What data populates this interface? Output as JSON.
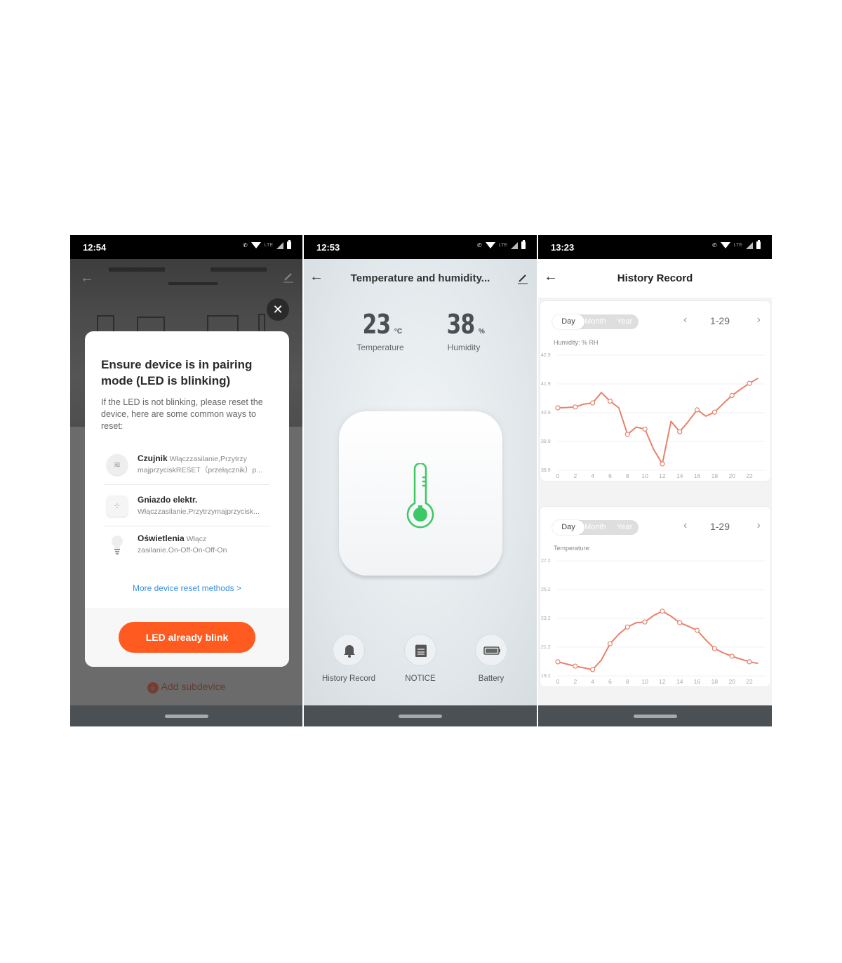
{
  "screens": [
    {
      "status": {
        "time": "12:54",
        "lte": "LTE"
      },
      "modal": {
        "title": "Ensure device is in pairing mode (LED is blinking)",
        "description": "If the LED is not blinking, please reset the device, here are some common ways to reset:",
        "methods": [
          {
            "icon": "sensor-icon",
            "name": "Czujnik",
            "text1": "Włączzasilanie,Przytrzy",
            "text2": "majprzyciskRESET（przełącznik）p..."
          },
          {
            "icon": "socket-icon",
            "name": "Gniazdo elektr.",
            "text1": "",
            "text2": "Włączzasilanie,Przytrzymajprzycisk..."
          },
          {
            "icon": "bulb-icon",
            "name": "Oświetlenia",
            "text1": "Włącz",
            "text2": "zasilanie.On-Off-On-Off-On"
          }
        ],
        "more_link": "More device reset methods >",
        "confirm_button": "LED already blink"
      },
      "add_subdevice": "Add subdevice"
    },
    {
      "status": {
        "time": "12:53",
        "lte": "LTE"
      },
      "title": "Temperature and humidity...",
      "temperature": {
        "value": "23",
        "unit": "°C",
        "label": "Temperature"
      },
      "humidity": {
        "value": "38",
        "unit": "%",
        "label": "Humidity"
      },
      "accent_color": "#3cc864",
      "actions": [
        {
          "icon": "bell-icon",
          "label": "History Record"
        },
        {
          "icon": "notepad-icon",
          "label": "NOTICE"
        },
        {
          "icon": "battery-icon",
          "label": "Battery"
        }
      ]
    },
    {
      "status": {
        "time": "13:23",
        "lte": "LTE"
      },
      "title": "History Record",
      "periods": [
        "Day",
        "Month",
        "Year"
      ],
      "selected_period": "Day",
      "range_label": "1-29",
      "line_color": "#e8826a"
    }
  ],
  "chart_data": [
    {
      "type": "line",
      "title": "Humidity: % RH",
      "xlabel": "",
      "ylabel": "",
      "x": [
        0,
        1,
        2,
        3,
        4,
        5,
        6,
        7,
        8,
        9,
        10,
        11,
        12,
        13,
        14,
        15,
        16,
        17,
        18,
        19,
        20,
        21,
        22,
        23
      ],
      "values": [
        41.07,
        41.08,
        41.1,
        41.2,
        41.24,
        41.6,
        41.3,
        41.07,
        40.15,
        40.4,
        40.33,
        39.63,
        39.12,
        40.6,
        40.24,
        40.6,
        41.0,
        40.78,
        40.92,
        41.22,
        41.5,
        41.72,
        41.92,
        42.1
      ],
      "markers_at": [
        0,
        2,
        4,
        6,
        8,
        10,
        12,
        14,
        16,
        18,
        20,
        22
      ],
      "yticks": [
        "42.9",
        "41.9",
        "40.9",
        "39.9",
        "38.9"
      ],
      "xticks": [
        "0",
        "2",
        "4",
        "6",
        "8",
        "10",
        "12",
        "14",
        "16",
        "18",
        "20",
        "22"
      ],
      "ylim": [
        38.9,
        42.9
      ],
      "grid": true
    },
    {
      "type": "line",
      "title": "Temperature:",
      "xlabel": "",
      "ylabel": "",
      "x": [
        0,
        1,
        2,
        3,
        4,
        5,
        6,
        7,
        8,
        9,
        10,
        11,
        12,
        13,
        14,
        15,
        16,
        17,
        18,
        19,
        20,
        21,
        22,
        23
      ],
      "values": [
        20.18,
        20.03,
        19.88,
        19.76,
        19.64,
        20.3,
        21.44,
        22.1,
        22.6,
        22.9,
        22.95,
        23.4,
        23.7,
        23.35,
        22.9,
        22.65,
        22.37,
        21.7,
        21.1,
        20.8,
        20.57,
        20.37,
        20.18,
        20.07
      ],
      "markers_at": [
        0,
        2,
        4,
        6,
        8,
        10,
        12,
        14,
        16,
        18,
        20,
        22
      ],
      "yticks": [
        "27.2",
        "25.2",
        "23.2",
        "21.2",
        "19.2"
      ],
      "xticks": [
        "0",
        "2",
        "4",
        "6",
        "8",
        "10",
        "12",
        "14",
        "16",
        "18",
        "20",
        "22"
      ],
      "ylim": [
        19.2,
        27.2
      ],
      "grid": true
    }
  ]
}
